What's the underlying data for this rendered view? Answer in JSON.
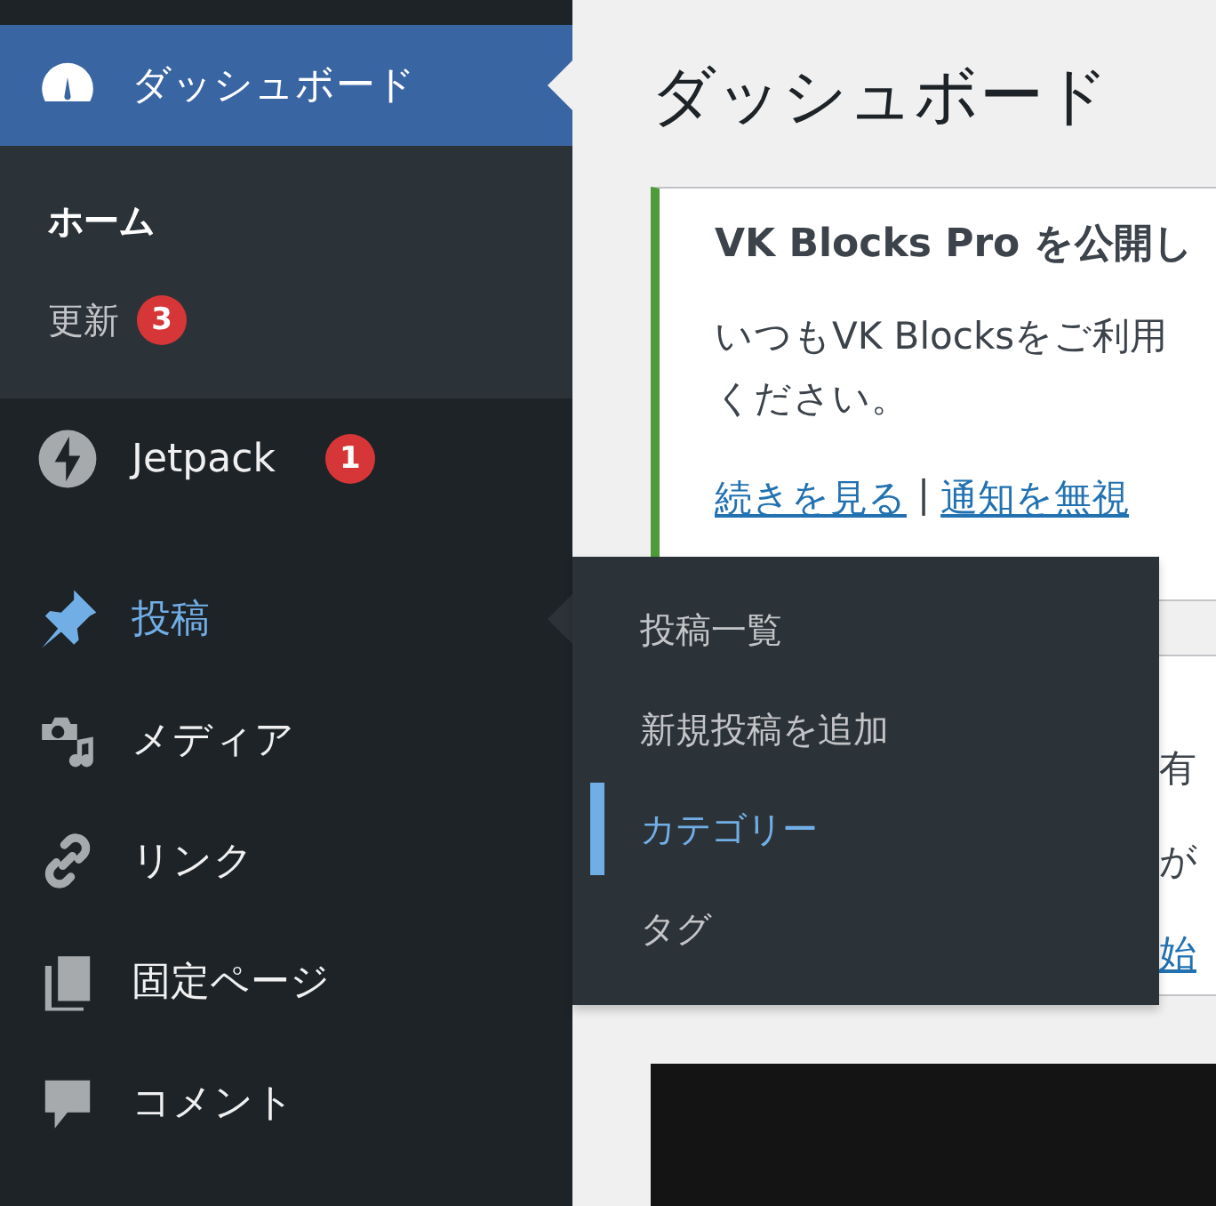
{
  "sidebar": {
    "items": [
      {
        "label": "ダッシュボード",
        "current": true,
        "open": false,
        "submenu": [
          {
            "label": "ホーム",
            "selected": true
          },
          {
            "label": "更新",
            "selected": false,
            "badge": "3"
          }
        ]
      },
      {
        "label": "Jetpack",
        "current": false,
        "open": false,
        "badge": "1"
      },
      {
        "label": "投稿",
        "current": false,
        "open": true,
        "group_start": true,
        "flyout": [
          {
            "label": "投稿一覧",
            "selected": false
          },
          {
            "label": "新規投稿を追加",
            "selected": false
          },
          {
            "label": "カテゴリー",
            "selected": true
          },
          {
            "label": "タグ",
            "selected": false
          }
        ]
      },
      {
        "label": "メディア",
        "current": false,
        "open": false
      },
      {
        "label": "リンク",
        "current": false,
        "open": false
      },
      {
        "label": "固定ページ",
        "current": false,
        "open": false
      },
      {
        "label": "コメント",
        "current": false,
        "open": false
      }
    ]
  },
  "page": {
    "title": "ダッシュボード",
    "notice": {
      "title": "VK Blocks Pro を公開し",
      "lines": [
        "いつもVK Blocksをご利用",
        "ください。"
      ],
      "links": [
        "続きを見る",
        "通知を無視"
      ],
      "separator": "|"
    },
    "notice_2": {
      "lines": [
        {
          "text": "有",
          "link": false
        },
        {
          "text": "が",
          "link": false
        },
        {
          "text": "始",
          "link": true
        }
      ]
    }
  }
}
